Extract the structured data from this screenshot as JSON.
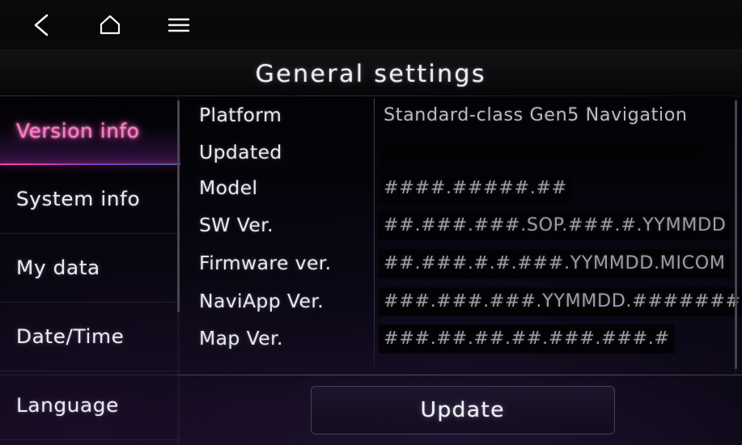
{
  "navbar": {
    "back_label": "Back",
    "home_label": "Home",
    "menu_label": "Menu",
    "icons": [
      "chevron-left-icon",
      "home-icon",
      "hamburger-menu-icon"
    ]
  },
  "header": {
    "title": "General settings"
  },
  "sidebar": {
    "items": [
      {
        "label": "Version info",
        "selected": true
      },
      {
        "label": "System info",
        "selected": false
      },
      {
        "label": "My data",
        "selected": false
      },
      {
        "label": "Date/Time",
        "selected": false
      },
      {
        "label": "Language",
        "selected": false
      }
    ],
    "selected_accent": "#ff7cc8",
    "underline_from": "#ff3fae",
    "underline_to": "#5a5f9c"
  },
  "content": {
    "rows": [
      {
        "label": "Platform",
        "value": "Standard-class Gen5 Navigation",
        "bright": true,
        "empty": false,
        "bg": false
      },
      {
        "label": "Updated",
        "value": "",
        "bright": false,
        "empty": true,
        "bg": true
      },
      {
        "label": "Model",
        "value": "####.#####.##",
        "bright": false,
        "empty": false,
        "bg": true
      },
      {
        "label": "SW Ver.",
        "value": "##.###.###.SOP.###.#.YYMMDD",
        "bright": false,
        "empty": false,
        "bg": true
      },
      {
        "label": "Firmware ver.",
        "value": "##.###.#.#.###.YYMMDD.MICOM",
        "bright": false,
        "empty": false,
        "bg": true
      },
      {
        "label": "NaviApp Ver.",
        "value": "###.###.###.YYMMDD.#######",
        "bright": false,
        "empty": false,
        "bg": true
      },
      {
        "label": "Map Ver.",
        "value": "###.##.##.##.###.###.#",
        "bright": false,
        "empty": false,
        "bg": true
      }
    ]
  },
  "footer": {
    "update_label": "Update"
  },
  "theme": {
    "background": "#0a0714",
    "text_primary": "#e9eaf0",
    "text_secondary": "#9b9ca6",
    "accent_pink": "#ff7cc8",
    "accent_purple": "#7a3ec4"
  }
}
